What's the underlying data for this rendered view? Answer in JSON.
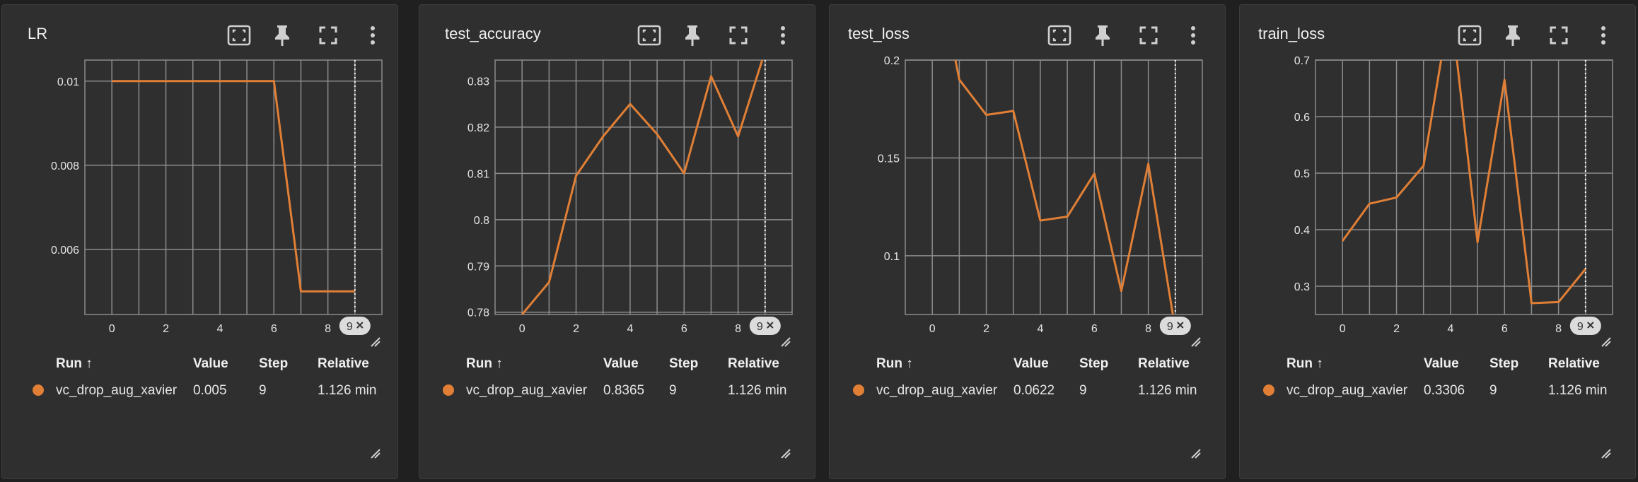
{
  "colors": {
    "background": "#202020",
    "card": "#2f2f2f",
    "series": "#e07f35",
    "grid": "#8c8c8c",
    "text": "#e6e6e6"
  },
  "toolbar": {
    "icons": [
      "fit-domain-icon",
      "pin-icon",
      "fullscreen-icon",
      "more-vert-icon"
    ]
  },
  "table": {
    "columns": [
      "Run ↑",
      "Value",
      "Step",
      "Relative"
    ]
  },
  "cards": [
    {
      "title": "LR",
      "row": {
        "run": "vc_drop_aug_xavier",
        "value": "0.005",
        "step": "9",
        "relative": "1.126 min"
      },
      "chart_data": {
        "type": "line",
        "x": [
          0,
          1,
          2,
          3,
          4,
          5,
          6,
          7,
          8,
          9
        ],
        "series": [
          {
            "values": [
              0.01,
              0.01,
              0.01,
              0.01,
              0.01,
              0.01,
              0.01,
              0.005,
              0.005,
              0.005
            ]
          }
        ],
        "xticks": [
          "0",
          "2",
          "4",
          "6",
          "8"
        ],
        "yticks": [
          "0.01",
          "0.008",
          "0.006"
        ],
        "ylim": [
          0.00445,
          0.0105
        ],
        "xlim": [
          -1,
          10
        ],
        "cursor_label": "9"
      }
    },
    {
      "title": "test_accuracy",
      "row": {
        "run": "vc_drop_aug_xavier",
        "value": "0.8365",
        "step": "9",
        "relative": "1.126 min"
      },
      "chart_data": {
        "type": "line",
        "x": [
          0,
          1,
          2,
          3,
          4,
          5,
          6,
          7,
          8,
          9
        ],
        "series": [
          {
            "values": [
              0.7795,
              0.7865,
              0.8095,
              0.818,
              0.825,
              0.8185,
              0.81,
              0.831,
              0.818,
              0.8365
            ]
          }
        ],
        "xticks": [
          "0",
          "2",
          "4",
          "6",
          "8"
        ],
        "yticks": [
          "0.83",
          "0.82",
          "0.81",
          "0.8",
          "0.79",
          "0.78"
        ],
        "ylim": [
          0.7795,
          0.8345
        ],
        "xlim": [
          -1,
          10
        ],
        "cursor_label": "9"
      }
    },
    {
      "title": "test_loss",
      "row": {
        "run": "vc_drop_aug_xavier",
        "value": "0.0622",
        "step": "9",
        "relative": "1.126 min"
      },
      "chart_data": {
        "type": "line",
        "x": [
          0,
          1,
          2,
          3,
          4,
          5,
          6,
          7,
          8,
          9
        ],
        "series": [
          {
            "values": [
              0.26,
              0.19,
              0.172,
              0.174,
              0.118,
              0.12,
              0.142,
              0.082,
              0.147,
              0.0622
            ]
          }
        ],
        "xticks": [
          "0",
          "2",
          "4",
          "6",
          "8"
        ],
        "yticks": [
          "0.2",
          "0.15",
          "0.1"
        ],
        "ylim": [
          0.07,
          0.2
        ],
        "xlim": [
          -1,
          10
        ],
        "cursor_label": "9"
      }
    },
    {
      "title": "train_loss",
      "row": {
        "run": "vc_drop_aug_xavier",
        "value": "0.3306",
        "step": "9",
        "relative": "1.126 min"
      },
      "chart_data": {
        "type": "line",
        "x": [
          0,
          1,
          2,
          3,
          4,
          5,
          6,
          7,
          8,
          9
        ],
        "series": [
          {
            "values": [
              0.38,
              0.446,
              0.457,
              0.513,
              0.8,
              0.378,
              0.665,
              0.27,
              0.272,
              0.3306
            ]
          }
        ],
        "xticks": [
          "0",
          "2",
          "4",
          "6",
          "8"
        ],
        "yticks": [
          "0.7",
          "0.6",
          "0.5",
          "0.4",
          "0.3"
        ],
        "ylim": [
          0.25,
          0.7
        ],
        "xlim": [
          -1,
          10
        ],
        "cursor_label": "9"
      }
    }
  ]
}
